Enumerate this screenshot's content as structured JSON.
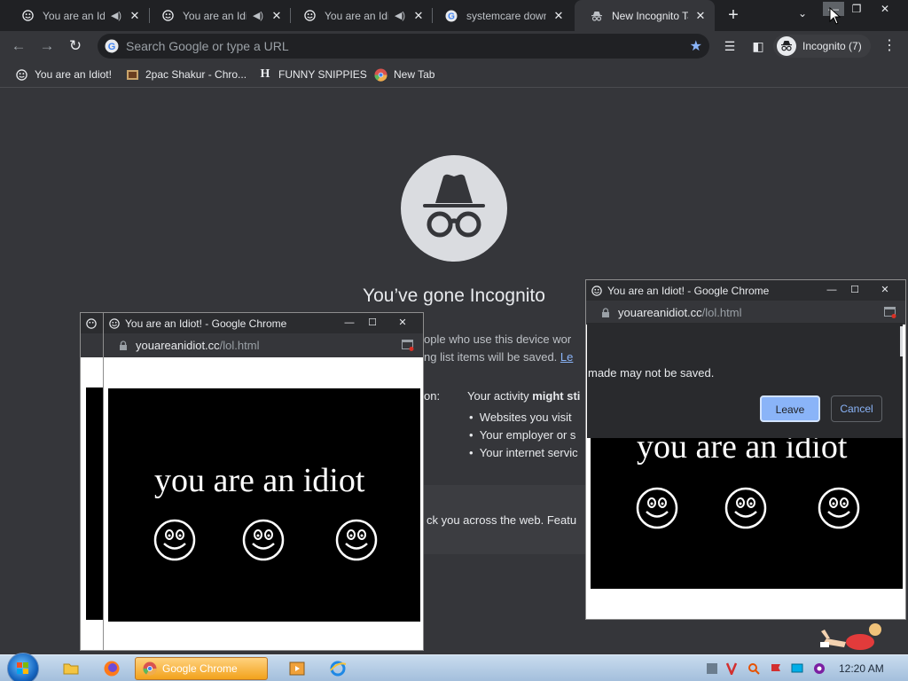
{
  "browser": {
    "tabs": [
      {
        "title": "You are an Idiot!",
        "icon": "smiley-icon",
        "audio": true
      },
      {
        "title": "You are an Idiot!",
        "icon": "smiley-icon",
        "audio": true
      },
      {
        "title": "You are an Idiot!",
        "icon": "smiley-icon",
        "audio": true
      },
      {
        "title": "systemcare download",
        "icon": "google-icon",
        "audio": false
      },
      {
        "title": "New Incognito Tab",
        "icon": "incognito-icon",
        "audio": false,
        "active": true
      }
    ],
    "omnibox_placeholder": "Search Google or type a URL",
    "profile_label": "Incognito (7)",
    "bookmarks": [
      {
        "label": "You are an Idiot!",
        "icon": "smiley-icon"
      },
      {
        "label": "2pac Shakur - Chro...",
        "icon": "image-icon"
      },
      {
        "label": "FUNNY SNIPPIES",
        "icon": "h-icon"
      },
      {
        "label": "New Tab",
        "icon": "chrome-icon"
      }
    ]
  },
  "incognito_page": {
    "heading": "You’ve gone Incognito",
    "text_fragments": {
      "line1": "ople who use this device wor",
      "line2": "ng list items will be saved.",
      "line2_link": "Le",
      "col_label": "on:",
      "col_heading_prefix": "Your activity ",
      "col_heading_bold": "might sti",
      "bullets": [
        "Websites you visit",
        "Your employer or s",
        "Your internet servic"
      ],
      "cookie_line": "ck you across the web. Featu"
    }
  },
  "popup_left": {
    "title": "You are an Idiot! - Google Chrome",
    "url_domain": "youareanidiot.cc",
    "url_path": "/lol.html",
    "content_text": "you are an idiot"
  },
  "popup_right": {
    "title": "You are an Idiot! - Google Chrome",
    "url_domain": "youareanidiot.cc",
    "url_path": "/lol.html",
    "content_text": "you are an idiot"
  },
  "dialog": {
    "message": "made may not be saved.",
    "leave_label": "Leave",
    "cancel_label": "Cancel"
  },
  "taskbar": {
    "active_app_label": "Google Chrome",
    "clock": "12:20 AM"
  },
  "colors": {
    "accent": "#8ab4f8",
    "chrome_dark": "#35363a",
    "tab_strip": "#202124"
  }
}
